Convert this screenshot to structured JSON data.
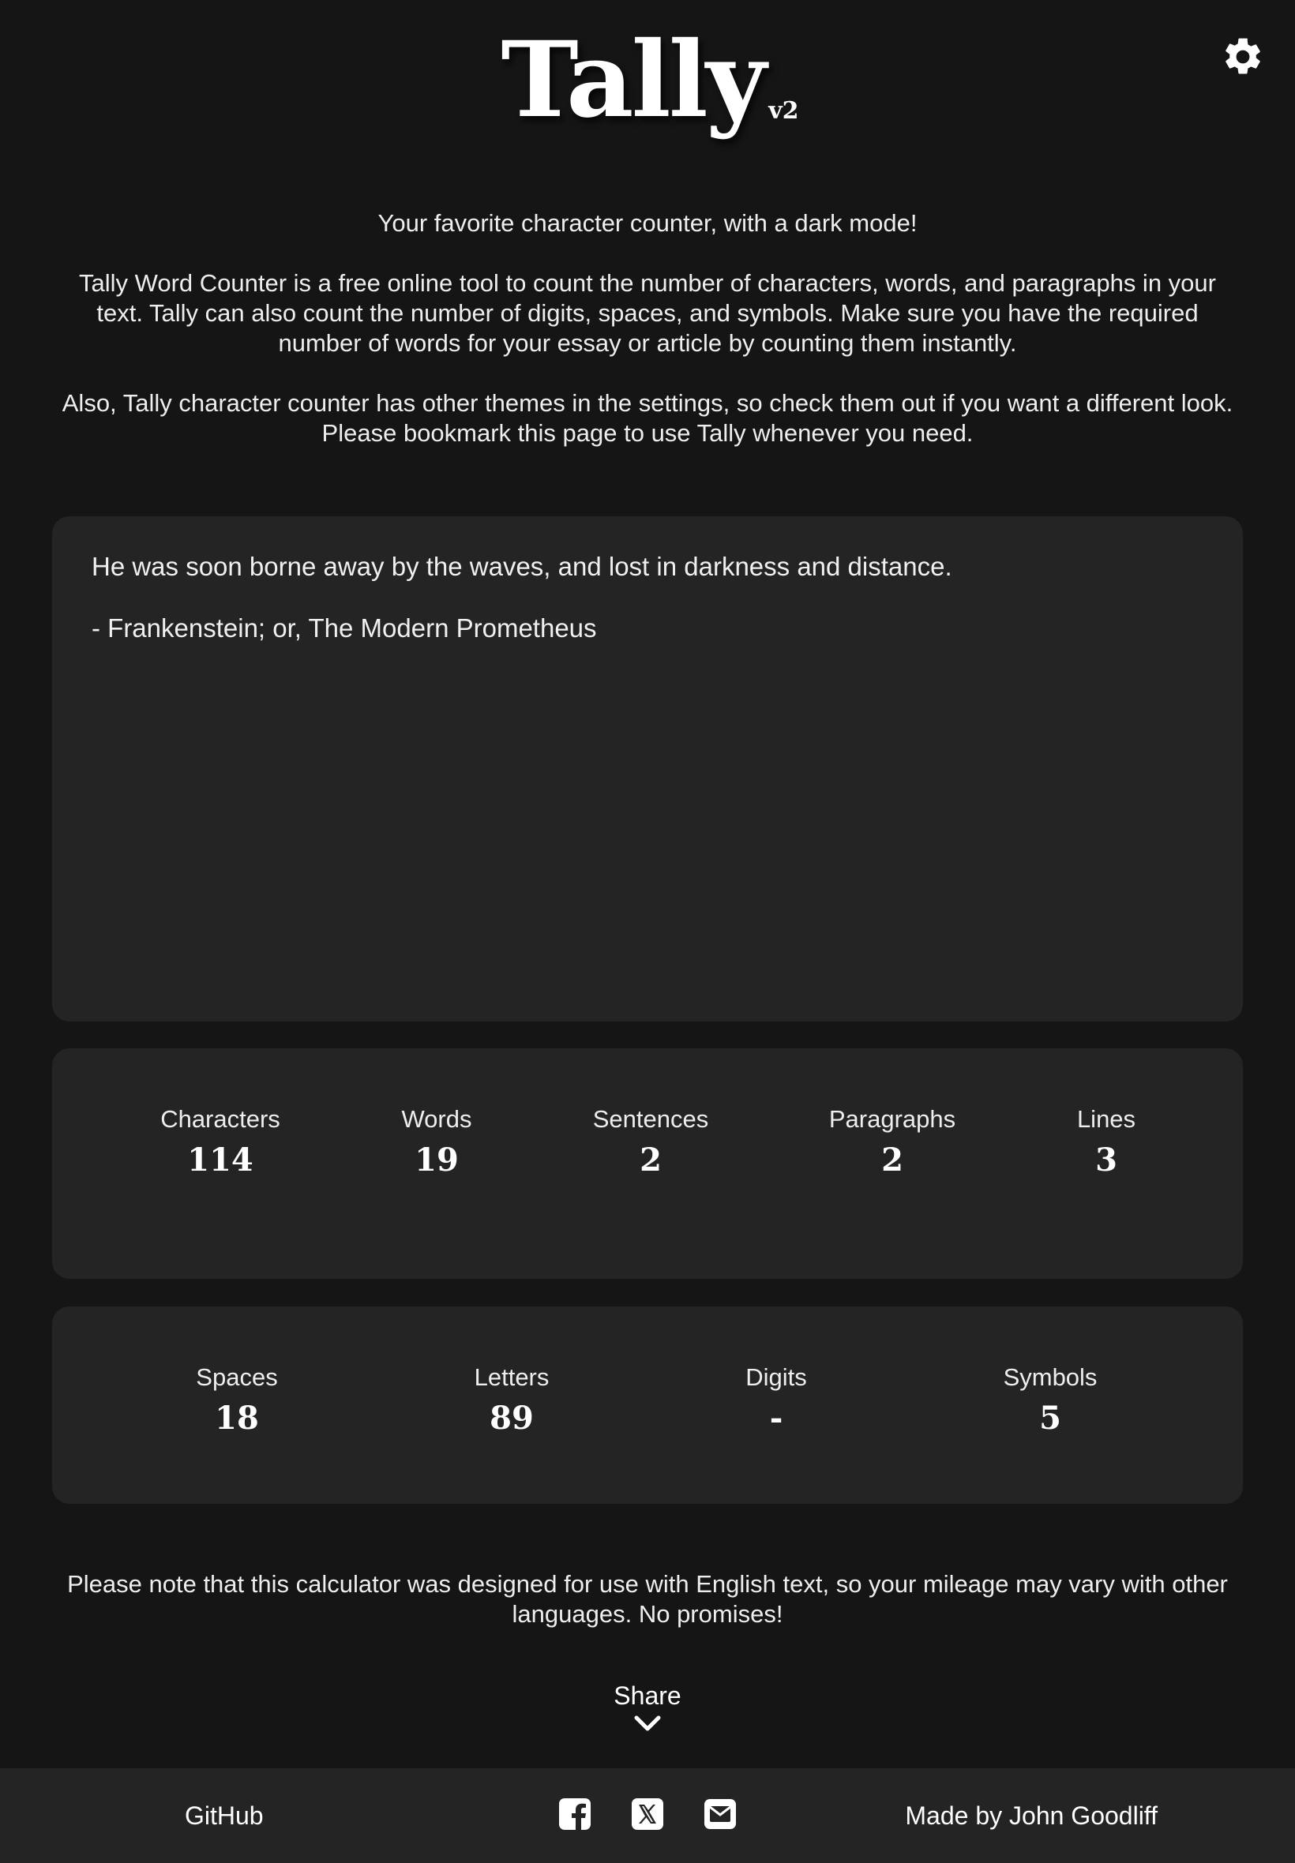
{
  "header": {
    "title": "Tally",
    "version": "v2",
    "settings_icon": "gear-icon"
  },
  "intro": {
    "tagline": "Your favorite character counter, with a dark mode!",
    "description": "Tally Word Counter is a free online tool to count the number of characters, words, and paragraphs in your text. Tally can also count the number of digits, spaces, and symbols. Make sure you have the required number of words for your essay or article by counting them instantly.",
    "themes_note": "Also, Tally character counter has other themes in the settings, so check them out if you want a different look. Please bookmark this page to use Tally whenever you need."
  },
  "editor": {
    "value": "He was soon borne away by the waves, and lost in darkness and distance.\n\n- Frankenstein; or, The Modern Prometheus"
  },
  "stats_primary": [
    {
      "label": "Characters",
      "value": "114"
    },
    {
      "label": "Words",
      "value": "19"
    },
    {
      "label": "Sentences",
      "value": "2"
    },
    {
      "label": "Paragraphs",
      "value": "2"
    },
    {
      "label": "Lines",
      "value": "3"
    }
  ],
  "stats_secondary": [
    {
      "label": "Spaces",
      "value": "18"
    },
    {
      "label": "Letters",
      "value": "89"
    },
    {
      "label": "Digits",
      "value": "-"
    },
    {
      "label": "Symbols",
      "value": "5"
    }
  ],
  "note": "Please note that this calculator was designed for use with English text, so your mileage may vary with other languages. No promises!",
  "share": {
    "label": "Share",
    "icon": "chevron-down-icon"
  },
  "footer": {
    "github_label": "GitHub",
    "social_icons": [
      "facebook-icon",
      "x-icon",
      "email-icon"
    ],
    "credit": "Made by John Goodliff"
  },
  "colors": {
    "background": "#151515",
    "panel": "#242424",
    "text": "#f2f2f2"
  }
}
